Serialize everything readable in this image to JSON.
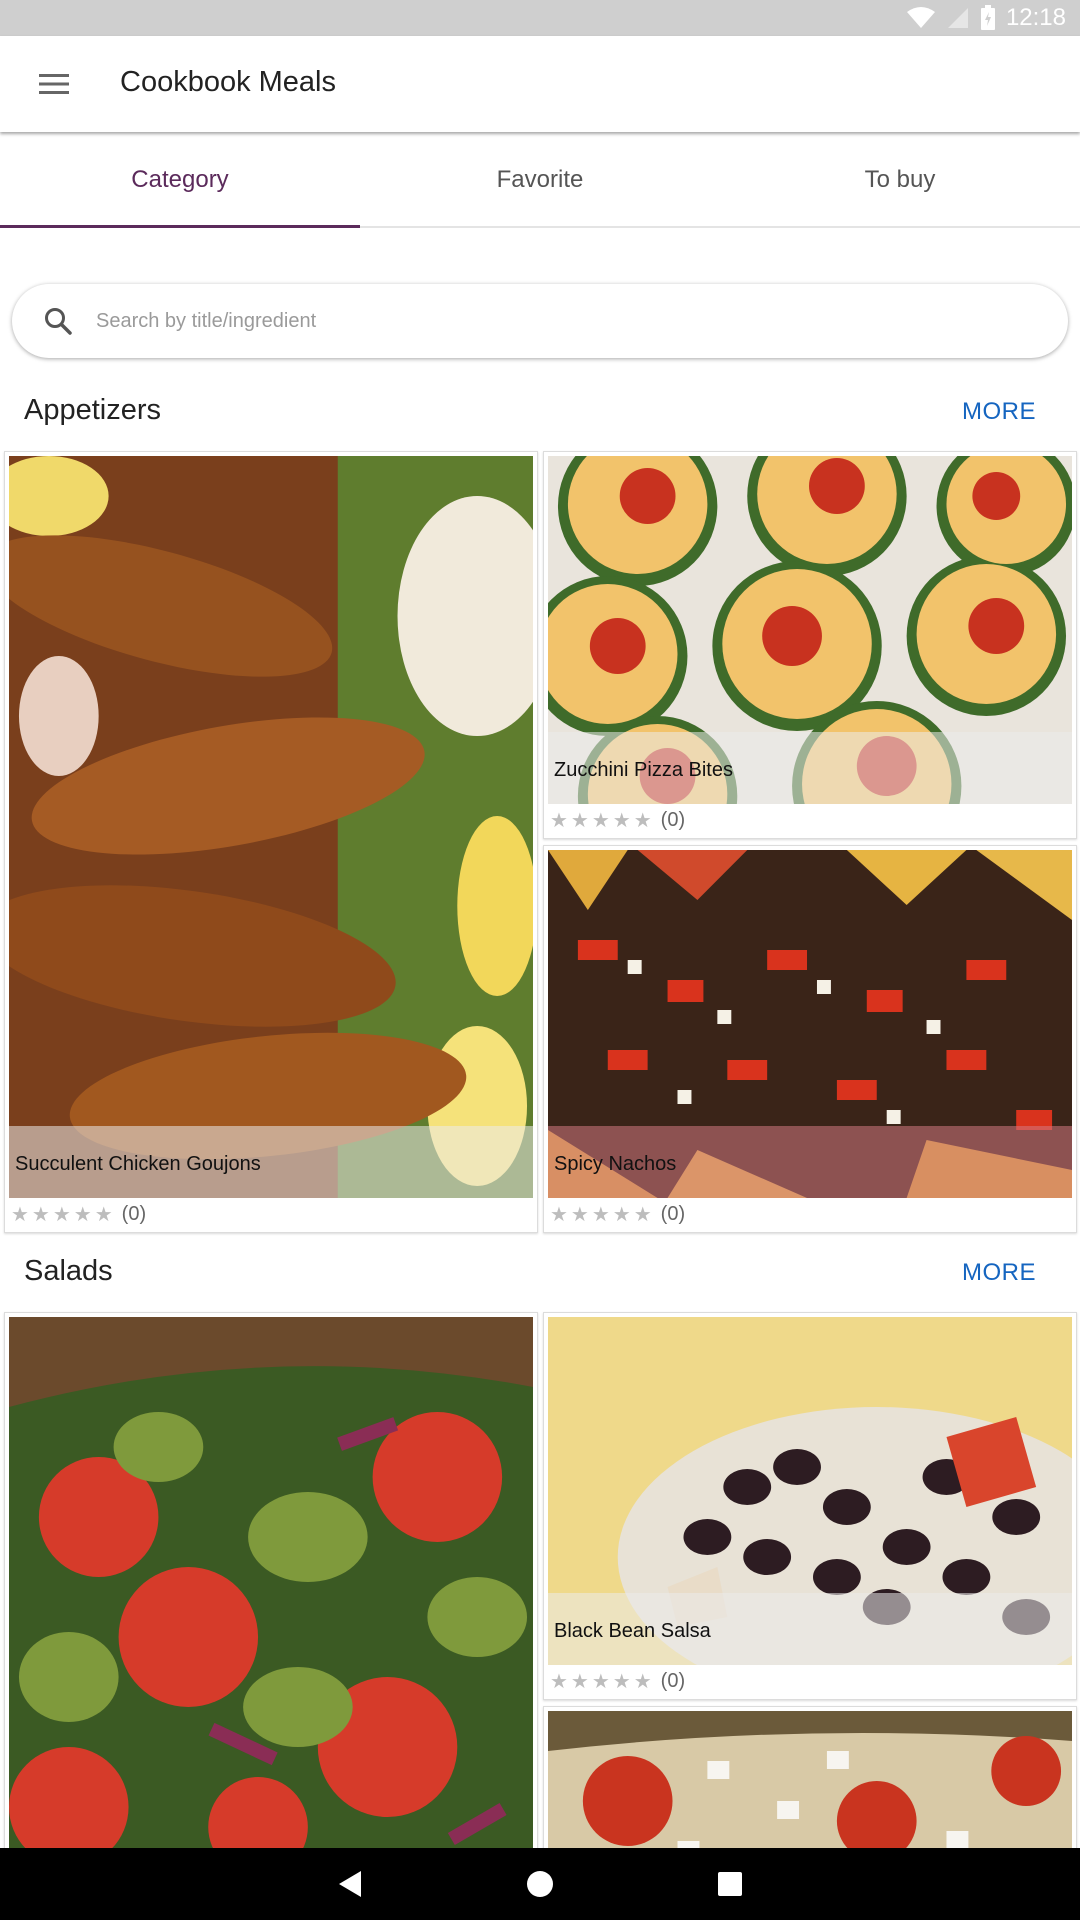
{
  "status": {
    "time": "12:18"
  },
  "app": {
    "title": "Cookbook Meals"
  },
  "tabs": [
    {
      "label": "Category",
      "active": true
    },
    {
      "label": "Favorite",
      "active": false
    },
    {
      "label": "To buy",
      "active": false
    }
  ],
  "search": {
    "placeholder": "Search by title/ingredient",
    "value": ""
  },
  "sections": [
    {
      "title": "Appetizers",
      "more": "MORE",
      "recipes": [
        {
          "title": "Succulent Chicken Goujons",
          "rating_count": "(0)",
          "stars": "★★★★★"
        },
        {
          "title": "Zucchini Pizza Bites",
          "rating_count": "(0)",
          "stars": "★★★★★"
        },
        {
          "title": "Spicy Nachos",
          "rating_count": "(0)",
          "stars": "★★★★★"
        }
      ]
    },
    {
      "title": "Salads",
      "more": "MORE",
      "recipes": [
        {
          "title": "",
          "rating_count": "",
          "stars": ""
        },
        {
          "title": "Black Bean Salsa",
          "rating_count": "(0)",
          "stars": "★★★★★"
        },
        {
          "title": "",
          "rating_count": "",
          "stars": ""
        }
      ]
    }
  ],
  "colors": {
    "accent": "#5b2a5b",
    "link": "#1565c0",
    "status_bar": "#cfcfcf",
    "nav_bar": "#000000"
  },
  "icons": {
    "menu": "hamburger-menu-icon",
    "search": "search-icon",
    "wifi": "wifi-icon",
    "signal": "signal-icon",
    "battery": "battery-icon",
    "back": "back-triangle-icon",
    "home": "home-circle-icon",
    "recents": "recents-square-icon"
  }
}
